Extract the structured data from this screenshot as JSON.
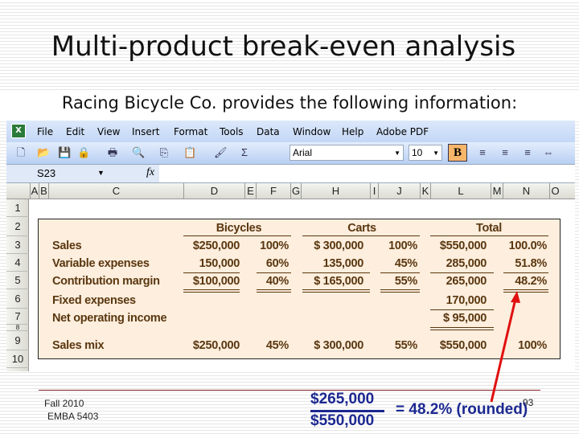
{
  "slide": {
    "title": "Multi-product break-even analysis",
    "subtitle": "Racing Bicycle Co. provides the following information:",
    "footer_line1": "Fall 2010",
    "footer_line2": "EMBA 5403",
    "page_number": "93",
    "numerator": "$265,000",
    "denominator": "$550,000",
    "result": "= 48.2% (rounded)",
    "arrow_color": "#e01010"
  },
  "excel": {
    "menu": [
      "File",
      "Edit",
      "View",
      "Insert",
      "Format",
      "Tools",
      "Data",
      "Window",
      "Help",
      "Adobe PDF"
    ],
    "font_name": "Arial",
    "font_size": "10",
    "bold_label": "B",
    "name_box": "S23",
    "fx_label": "fx",
    "columns": [
      "A",
      "B",
      "C",
      "D",
      "E",
      "F",
      "G",
      "H",
      "I",
      "J",
      "K",
      "L",
      "M",
      "N",
      "O"
    ],
    "rows": [
      "1",
      "2",
      "3",
      "4",
      "5",
      "6",
      "7",
      "8",
      "9",
      "10"
    ],
    "toolbar_icons": [
      "new-icon",
      "open-icon",
      "save-icon",
      "permission-icon",
      "print-icon",
      "research-icon",
      "copy-icon",
      "paste-icon",
      "format-painter-icon",
      "autosum-icon",
      "align-left-icon",
      "align-center-icon",
      "align-right-icon",
      "merge-center-icon"
    ]
  },
  "sheet": {
    "headers": {
      "bicycles": "Bicycles",
      "carts": "Carts",
      "total": "Total"
    },
    "lines": [
      {
        "label": "Sales",
        "b_amt": "$250,000",
        "b_pct": "100%",
        "c_amt": "$  300,000",
        "c_pct": "100%",
        "t_amt": "$550,000",
        "t_pct": "100.0%"
      },
      {
        "label": "Variable expenses",
        "b_amt": "150,000",
        "b_pct": "60%",
        "c_amt": "135,000",
        "c_pct": "45%",
        "t_amt": "285,000",
        "t_pct": "51.8%"
      },
      {
        "label": "Contribution margin",
        "b_amt": "$100,000",
        "b_pct": "40%",
        "c_amt": "$  165,000",
        "c_pct": "55%",
        "t_amt": "265,000",
        "t_pct": "48.2%"
      },
      {
        "label": "Fixed expenses",
        "b_amt": "",
        "b_pct": "",
        "c_amt": "",
        "c_pct": "",
        "t_amt": "170,000",
        "t_pct": ""
      },
      {
        "label": "Net operating income",
        "b_amt": "",
        "b_pct": "",
        "c_amt": "",
        "c_pct": "",
        "t_amt": "$  95,000",
        "t_pct": ""
      },
      {
        "label": "Sales mix",
        "b_amt": "$250,000",
        "b_pct": "45%",
        "c_amt": "$  300,000",
        "c_pct": "55%",
        "t_amt": "$550,000",
        "t_pct": "100%"
      }
    ]
  }
}
